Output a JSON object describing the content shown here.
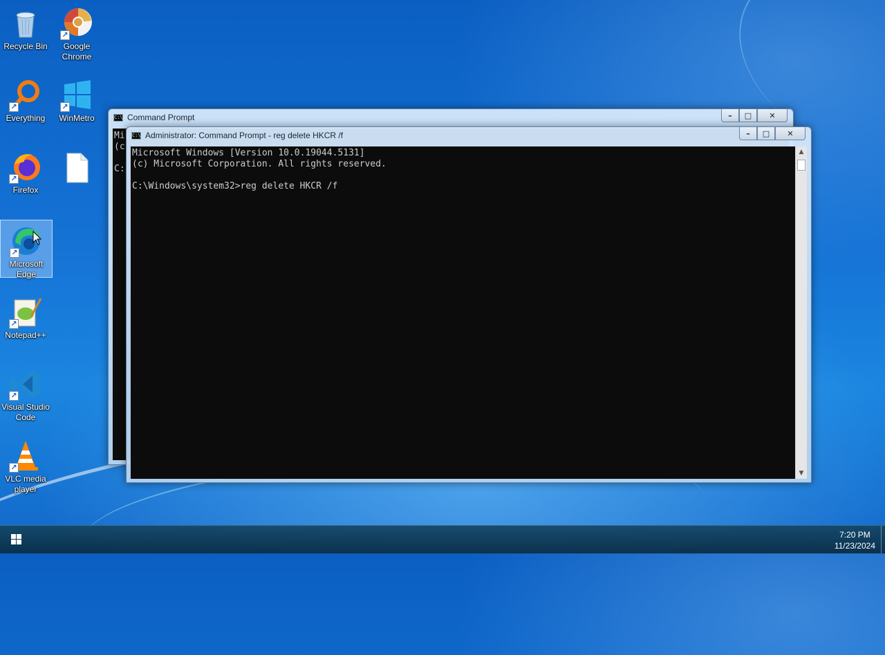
{
  "desktop": {
    "icons": [
      {
        "label": "Recycle Bin"
      },
      {
        "label": "Google\nChrome"
      },
      {
        "label": "Everything"
      },
      {
        "label": "WinMetro"
      },
      {
        "label": "Firefox"
      },
      {
        "label": ""
      },
      {
        "label": "Microsoft\nEdge"
      },
      {
        "label": "Notepad++"
      },
      {
        "label": "Visual Studio\nCode"
      },
      {
        "label": "VLC media\nplayer"
      }
    ]
  },
  "back_window": {
    "title": "Command Prompt",
    "visible_text": "Mic\n(c\n\nC:"
  },
  "front_window": {
    "title": "Administrator: Command Prompt - reg  delete HKCR /f",
    "console_lines": "Microsoft Windows [Version 10.0.19044.5131]\n(c) Microsoft Corporation. All rights reserved.\n\nC:\\Windows\\system32>reg delete HKCR /f"
  },
  "window_controls": {
    "minimize": "–",
    "maximize": "□",
    "close": "✕"
  },
  "taskbar": {
    "time": "7:20 PM",
    "date": "11/23/2024"
  },
  "icons_semantic": [
    "windows-logo-icon",
    "recycle-bin-icon",
    "chrome-icon",
    "everything-icon",
    "winmetro-icon",
    "firefox-icon",
    "file-icon",
    "edge-icon",
    "notepadpp-icon",
    "vscode-icon",
    "vlc-icon",
    "cmd-icon",
    "mouse-cursor-icon"
  ],
  "colors": {
    "console_bg": "#0c0c0c",
    "console_fg": "#cccccc",
    "desktop_blue": "#1573d6"
  }
}
